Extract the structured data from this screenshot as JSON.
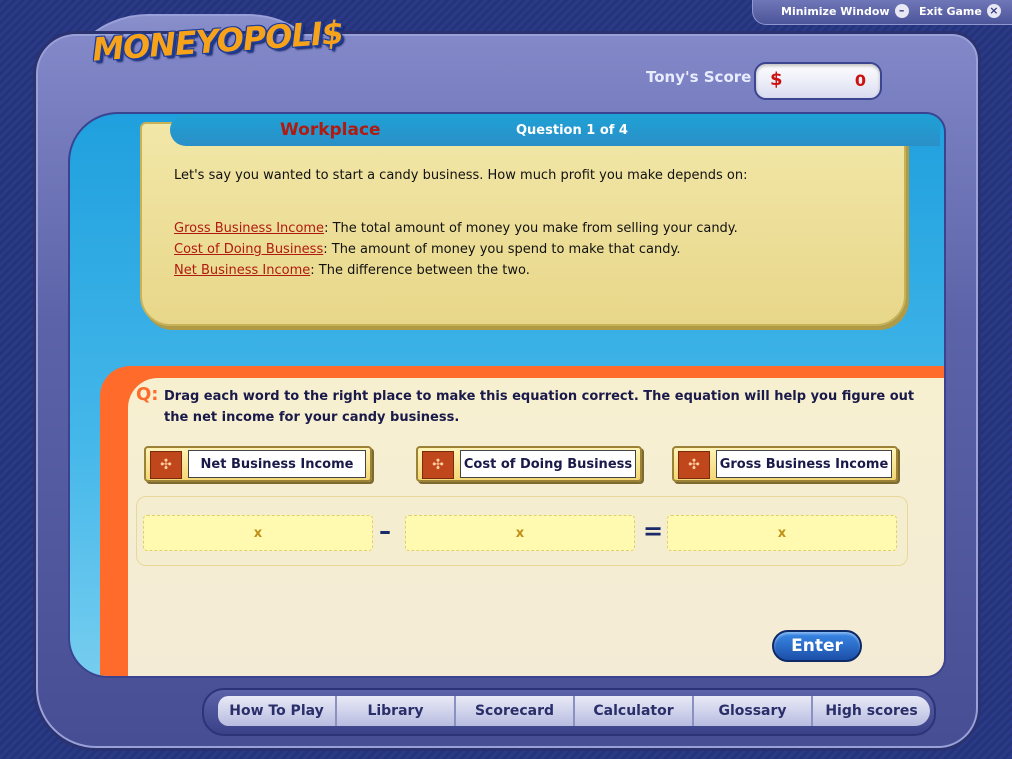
{
  "window": {
    "minimize_label": "Minimize Window",
    "minimize_glyph": "–",
    "exit_label": "Exit Game",
    "exit_glyph": "×"
  },
  "brand": {
    "logo_text": "MONEYOPOLI$"
  },
  "score": {
    "label": "Tony's Score",
    "currency": "$",
    "value": "0"
  },
  "lesson": {
    "section": "Workplace",
    "progress": "Question 1 of 4",
    "intro": "Let's say you wanted to start a candy business. How much profit you make depends on:",
    "definitions": [
      {
        "term": "Gross Business Income",
        "text": ": The total amount of money you make from selling your candy."
      },
      {
        "term": "Cost of Doing Business",
        "text": ": The amount of money you spend to make that candy."
      },
      {
        "term": "Net Business Income",
        "text": ": The difference between the two."
      }
    ]
  },
  "question": {
    "marker": "Q:",
    "text": "Drag each word to the right place to make this equation correct.  The equation will help you figure out the net income for your candy business.",
    "words": [
      "Net Business Income",
      "Cost of Doing Business",
      "Gross Business Income"
    ],
    "slots": [
      "x",
      "x",
      "x"
    ],
    "operators": [
      "–",
      "="
    ],
    "enter_label": "Enter"
  },
  "nav": {
    "items": [
      "How To Play",
      "Library",
      "Scorecard",
      "Calculator",
      "Glossary",
      "High scores"
    ]
  },
  "colors": {
    "accent_orange": "#ff6b2a",
    "title_red": "#b01a10",
    "screen_blue": "#1fa0de"
  }
}
